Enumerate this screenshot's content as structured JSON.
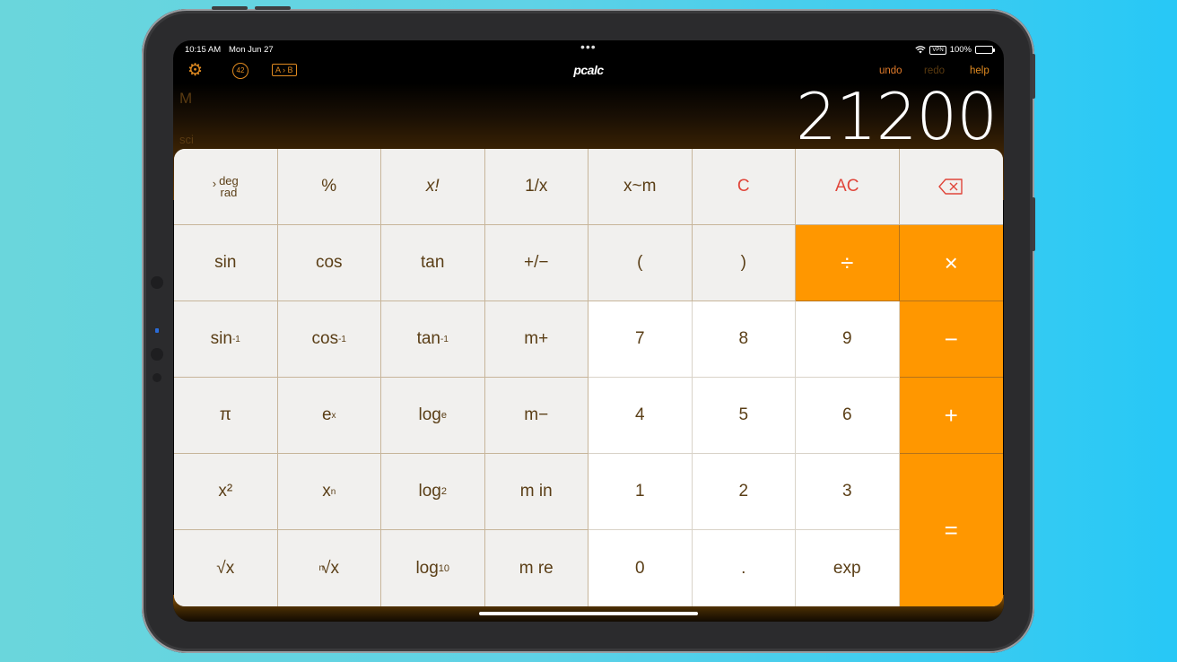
{
  "status_bar": {
    "time": "10:15 AM",
    "date": "Mon Jun 27",
    "multitask": "•••",
    "vpn": "VPN",
    "battery": "100%"
  },
  "toolbar": {
    "settings_icon": "gear-icon",
    "badge": "42",
    "ab": "A › B",
    "logo": "pcalc",
    "undo": "undo",
    "redo": "redo",
    "help": "help"
  },
  "display": {
    "memory_indicator": "M",
    "mode_indicator": "sci",
    "value": "21200"
  },
  "keys": {
    "deg": "deg",
    "rad": "rad",
    "percent": "%",
    "factorial": "x!",
    "reciprocal": "1/x",
    "swap_m": "x~m",
    "clear": "C",
    "all_clear": "AC",
    "sin": "sin",
    "cos": "cos",
    "tan": "tan",
    "plus_minus": "+/−",
    "open_paren": "(",
    "close_paren": ")",
    "divide": "÷",
    "multiply": "×",
    "asin_base": "sin",
    "acos_base": "cos",
    "atan_base": "tan",
    "inverse_exp": "-1",
    "m_plus": "m+",
    "d7": "7",
    "d8": "8",
    "d9": "9",
    "minus": "−",
    "pi": "π",
    "ex_base": "e",
    "ex_exp": "x",
    "loge_base": "log",
    "loge_sub": "e",
    "m_minus": "m−",
    "d4": "4",
    "d5": "5",
    "d6": "6",
    "plus": "+",
    "x_squared": "x²",
    "xn_base": "x",
    "xn_exp": "n",
    "log2_base": "log",
    "log2_sub": "2",
    "m_in": "m in",
    "d1": "1",
    "d2": "2",
    "d3": "3",
    "equals": "=",
    "sqrt": "√x",
    "nroot_index": "n",
    "nroot_base": "√x",
    "log10_base": "log",
    "log10_sub": "10",
    "m_re": "m re",
    "d0": "0",
    "decimal": ".",
    "exp": "exp"
  },
  "colors": {
    "accent_orange": "#ff9700",
    "clear_red": "#e0453a",
    "key_text": "#5a3e16"
  }
}
